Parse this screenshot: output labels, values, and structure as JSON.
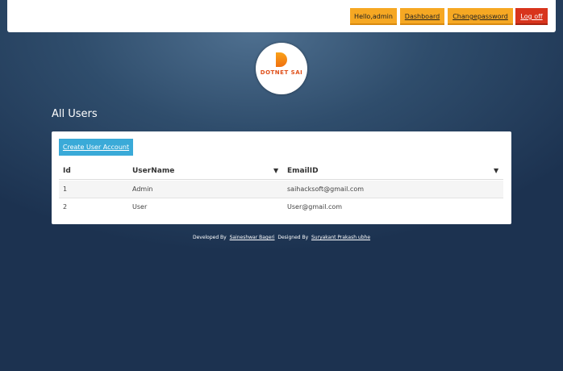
{
  "topbar": {
    "greeting": "Hello,admin",
    "dashboard": "Dashboard",
    "change_password": "Changepassword",
    "logoff": "Log off"
  },
  "logo": {
    "text": "DOTNET SAI"
  },
  "page_title": "All Users",
  "create_button": "Create User Account",
  "table": {
    "headers": [
      "Id",
      "UserName",
      "EmailID"
    ],
    "rows": [
      [
        "1",
        "Admin",
        "saihacksoft@gmail.com"
      ],
      [
        "2",
        "User",
        "User@gmail.com"
      ]
    ]
  },
  "footer": {
    "developed_label": "Developed By",
    "developer": "Saineshwar Bageri",
    "designed_label": "Designed By",
    "designer": "Suryakant Prakash ubhe"
  },
  "icons": {
    "filter": "▼"
  }
}
